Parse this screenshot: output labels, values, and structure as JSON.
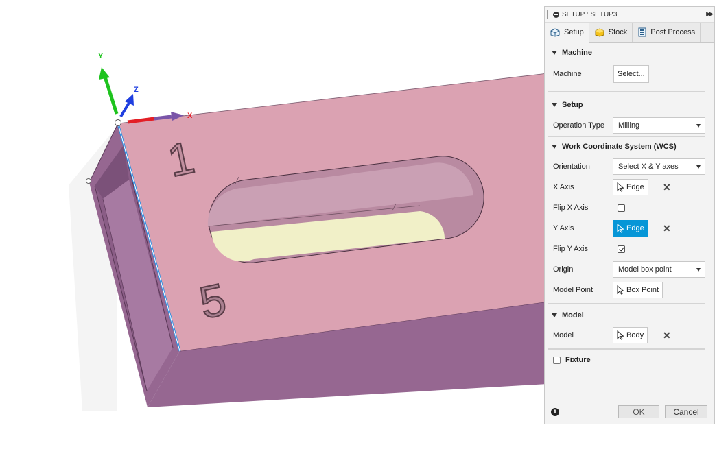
{
  "viewport": {
    "axis_y": "Y",
    "axis_z": "Z",
    "axis_x": "X",
    "engraving_top": "1",
    "engraving_bottom": "5",
    "colors": {
      "part_top": "#dba2b2",
      "part_side": "#966791",
      "slot_floor": "#f1f0c8",
      "axis_x": "#e31f26",
      "axis_y": "#1ec31e",
      "axis_z": "#1f3fe0"
    }
  },
  "panel": {
    "title": "SETUP : SETUP3",
    "tabs": [
      {
        "label": "Setup",
        "icon": "setup-icon"
      },
      {
        "label": "Stock",
        "icon": "stock-icon"
      },
      {
        "label": "Post Process",
        "icon": "post-process-icon"
      }
    ],
    "machine": {
      "heading": "Machine",
      "label": "Machine",
      "button": "Select..."
    },
    "setup": {
      "heading": "Setup",
      "operation_type_label": "Operation Type",
      "operation_type_value": "Milling"
    },
    "wcs": {
      "heading": "Work Coordinate System (WCS)",
      "orientation_label": "Orientation",
      "orientation_value": "Select X & Y axes",
      "x_axis_label": "X Axis",
      "x_axis_value": "Edge",
      "flip_x_label": "Flip X Axis",
      "flip_x_checked": false,
      "y_axis_label": "Y Axis",
      "y_axis_value": "Edge",
      "flip_y_label": "Flip Y Axis",
      "flip_y_checked": true,
      "origin_label": "Origin",
      "origin_value": "Model box point",
      "model_point_label": "Model Point",
      "model_point_value": "Box Point"
    },
    "model": {
      "heading": "Model",
      "label": "Model",
      "value": "Body"
    },
    "fixture": {
      "label": "Fixture",
      "checked": false
    },
    "footer": {
      "ok": "OK",
      "cancel": "Cancel"
    },
    "accent": "#0696d7"
  }
}
